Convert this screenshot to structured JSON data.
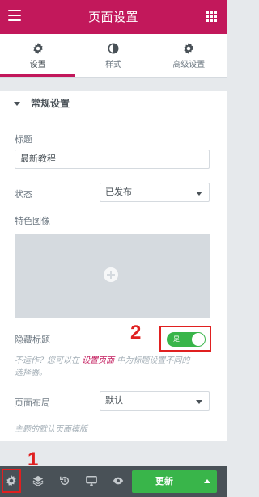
{
  "header": {
    "title": "页面设置",
    "menu_icon": "hamburger-icon",
    "apps_icon": "grid-icon"
  },
  "tabs": [
    {
      "label": "设置",
      "icon": "gear-icon",
      "active": true
    },
    {
      "label": "样式",
      "icon": "half-circle-icon",
      "active": false
    },
    {
      "label": "高级设置",
      "icon": "gear-icon",
      "active": false
    }
  ],
  "section": {
    "label": "常规设置"
  },
  "form": {
    "title_label": "标题",
    "title_value": "最新教程",
    "status_label": "状态",
    "status_value": "已发布",
    "featured_image_label": "特色图像",
    "hide_title_label": "隐藏标题",
    "hide_title_toggle_text": "是",
    "hide_title_toggle_on": true,
    "help_part1": "不运作？您可以在",
    "help_link": "设置页面",
    "help_part2": "中为标题设置不同的",
    "help_line2": "选择器。",
    "layout_label": "页面布局",
    "layout_value": "默认",
    "layout_help": "主题的默认页面模版"
  },
  "annotations": {
    "marker_1": "1",
    "marker_2": "2"
  },
  "footer": {
    "icons": [
      "gear-icon",
      "layers-icon",
      "history-icon",
      "desktop-icon",
      "eye-icon"
    ],
    "update_label": "更新"
  },
  "colors": {
    "brand": "#c2185b",
    "success": "#39b54a",
    "toolbar": "#495157",
    "annotation": "#e02020"
  }
}
